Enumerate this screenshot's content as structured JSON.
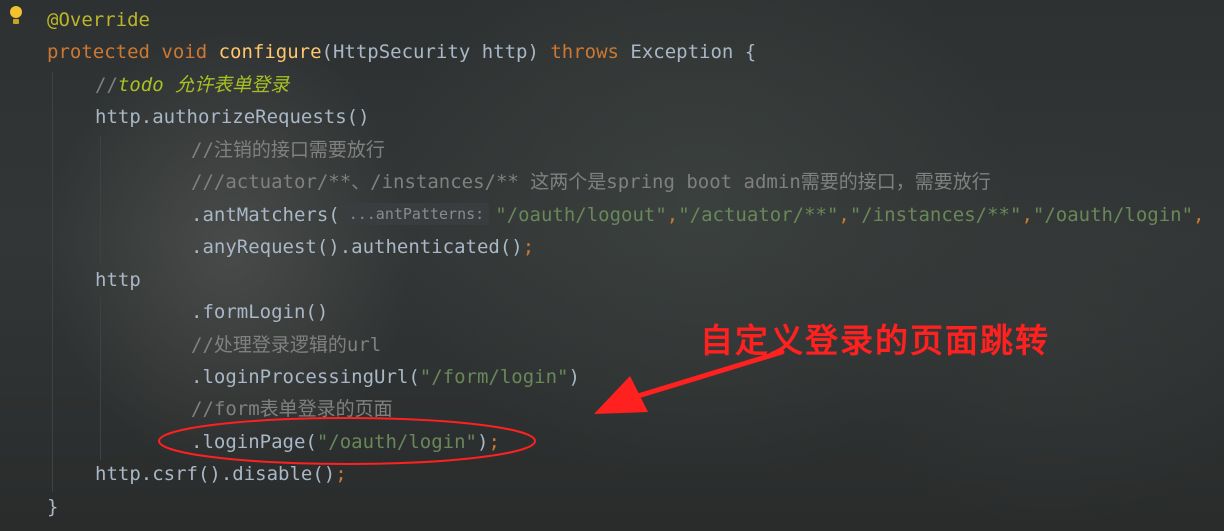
{
  "editor": {
    "gutter": {
      "icon": "lightbulb-icon"
    },
    "lines": [
      {
        "tokens": [
          {
            "text": "@Override",
            "kind": "annotation"
          }
        ]
      },
      {
        "tokens": [
          {
            "text": "protected void ",
            "kind": "keyword"
          },
          {
            "text": "configure",
            "kind": "function"
          },
          {
            "text": "(HttpSecurity http) ",
            "kind": "plain"
          },
          {
            "text": "throws ",
            "kind": "keyword"
          },
          {
            "text": "Exception {",
            "kind": "plain"
          }
        ]
      },
      {
        "tokens": [
          {
            "text": "//",
            "kind": "comment"
          },
          {
            "text": "todo 允许表单登录",
            "kind": "todo"
          }
        ]
      },
      {
        "tokens": [
          {
            "text": "http.authorizeRequests()",
            "kind": "plain"
          }
        ]
      },
      {
        "tokens": [
          {
            "text": "//注销的接口需要放行",
            "kind": "comment"
          }
        ]
      },
      {
        "tokens": [
          {
            "text": "///actuator/**、/instances/** 这两个是spring boot admin需要的接口，需要放行",
            "kind": "comment"
          }
        ]
      },
      {
        "tokens": [
          {
            "text": ".antMatchers(",
            "kind": "plain"
          },
          {
            "text": "...antPatterns:",
            "kind": "hint"
          },
          {
            "text": "\"/oauth/logout\"",
            "kind": "string"
          },
          {
            "text": ",",
            "kind": "keyword"
          },
          {
            "text": "\"/actuator/**\"",
            "kind": "string"
          },
          {
            "text": ",",
            "kind": "keyword"
          },
          {
            "text": "\"/instances/**\"",
            "kind": "string"
          },
          {
            "text": ",",
            "kind": "keyword"
          },
          {
            "text": "\"/oauth/login\"",
            "kind": "string"
          },
          {
            "text": ",",
            "kind": "keyword"
          }
        ]
      },
      {
        "tokens": [
          {
            "text": ".anyRequest().authenticated()",
            "kind": "plain"
          },
          {
            "text": ";",
            "kind": "keyword"
          }
        ]
      },
      {
        "tokens": [
          {
            "text": "http",
            "kind": "plain"
          }
        ]
      },
      {
        "tokens": [
          {
            "text": ".formLogin()",
            "kind": "plain"
          }
        ]
      },
      {
        "tokens": [
          {
            "text": "//处理登录逻辑的url",
            "kind": "comment"
          }
        ]
      },
      {
        "tokens": [
          {
            "text": ".loginProcessingUrl(",
            "kind": "plain"
          },
          {
            "text": "\"/form/login\"",
            "kind": "string"
          },
          {
            "text": ")",
            "kind": "plain"
          }
        ]
      },
      {
        "tokens": [
          {
            "text": "//form表单登录的页面",
            "kind": "comment"
          }
        ]
      },
      {
        "tokens": [
          {
            "text": ".loginPage(",
            "kind": "plain"
          },
          {
            "text": "\"/oauth/login\"",
            "kind": "string"
          },
          {
            "text": ")",
            "kind": "plain"
          },
          {
            "text": ";",
            "kind": "keyword"
          }
        ]
      },
      {
        "tokens": [
          {
            "text": "http.csrf().disable()",
            "kind": "plain"
          },
          {
            "text": ";",
            "kind": "keyword"
          }
        ]
      },
      {
        "tokens": [
          {
            "text": "}",
            "kind": "plain"
          }
        ]
      }
    ]
  },
  "annotation": {
    "callout_text": "自定义登录的页面跳转",
    "color": "#ff2020"
  },
  "colors": {
    "keyword": "#cc7832",
    "annotation": "#bbb529",
    "function": "#ffc66d",
    "string": "#6a8759",
    "comment": "#808080",
    "todo": "#a8c023",
    "plain": "#a9b7c6"
  }
}
